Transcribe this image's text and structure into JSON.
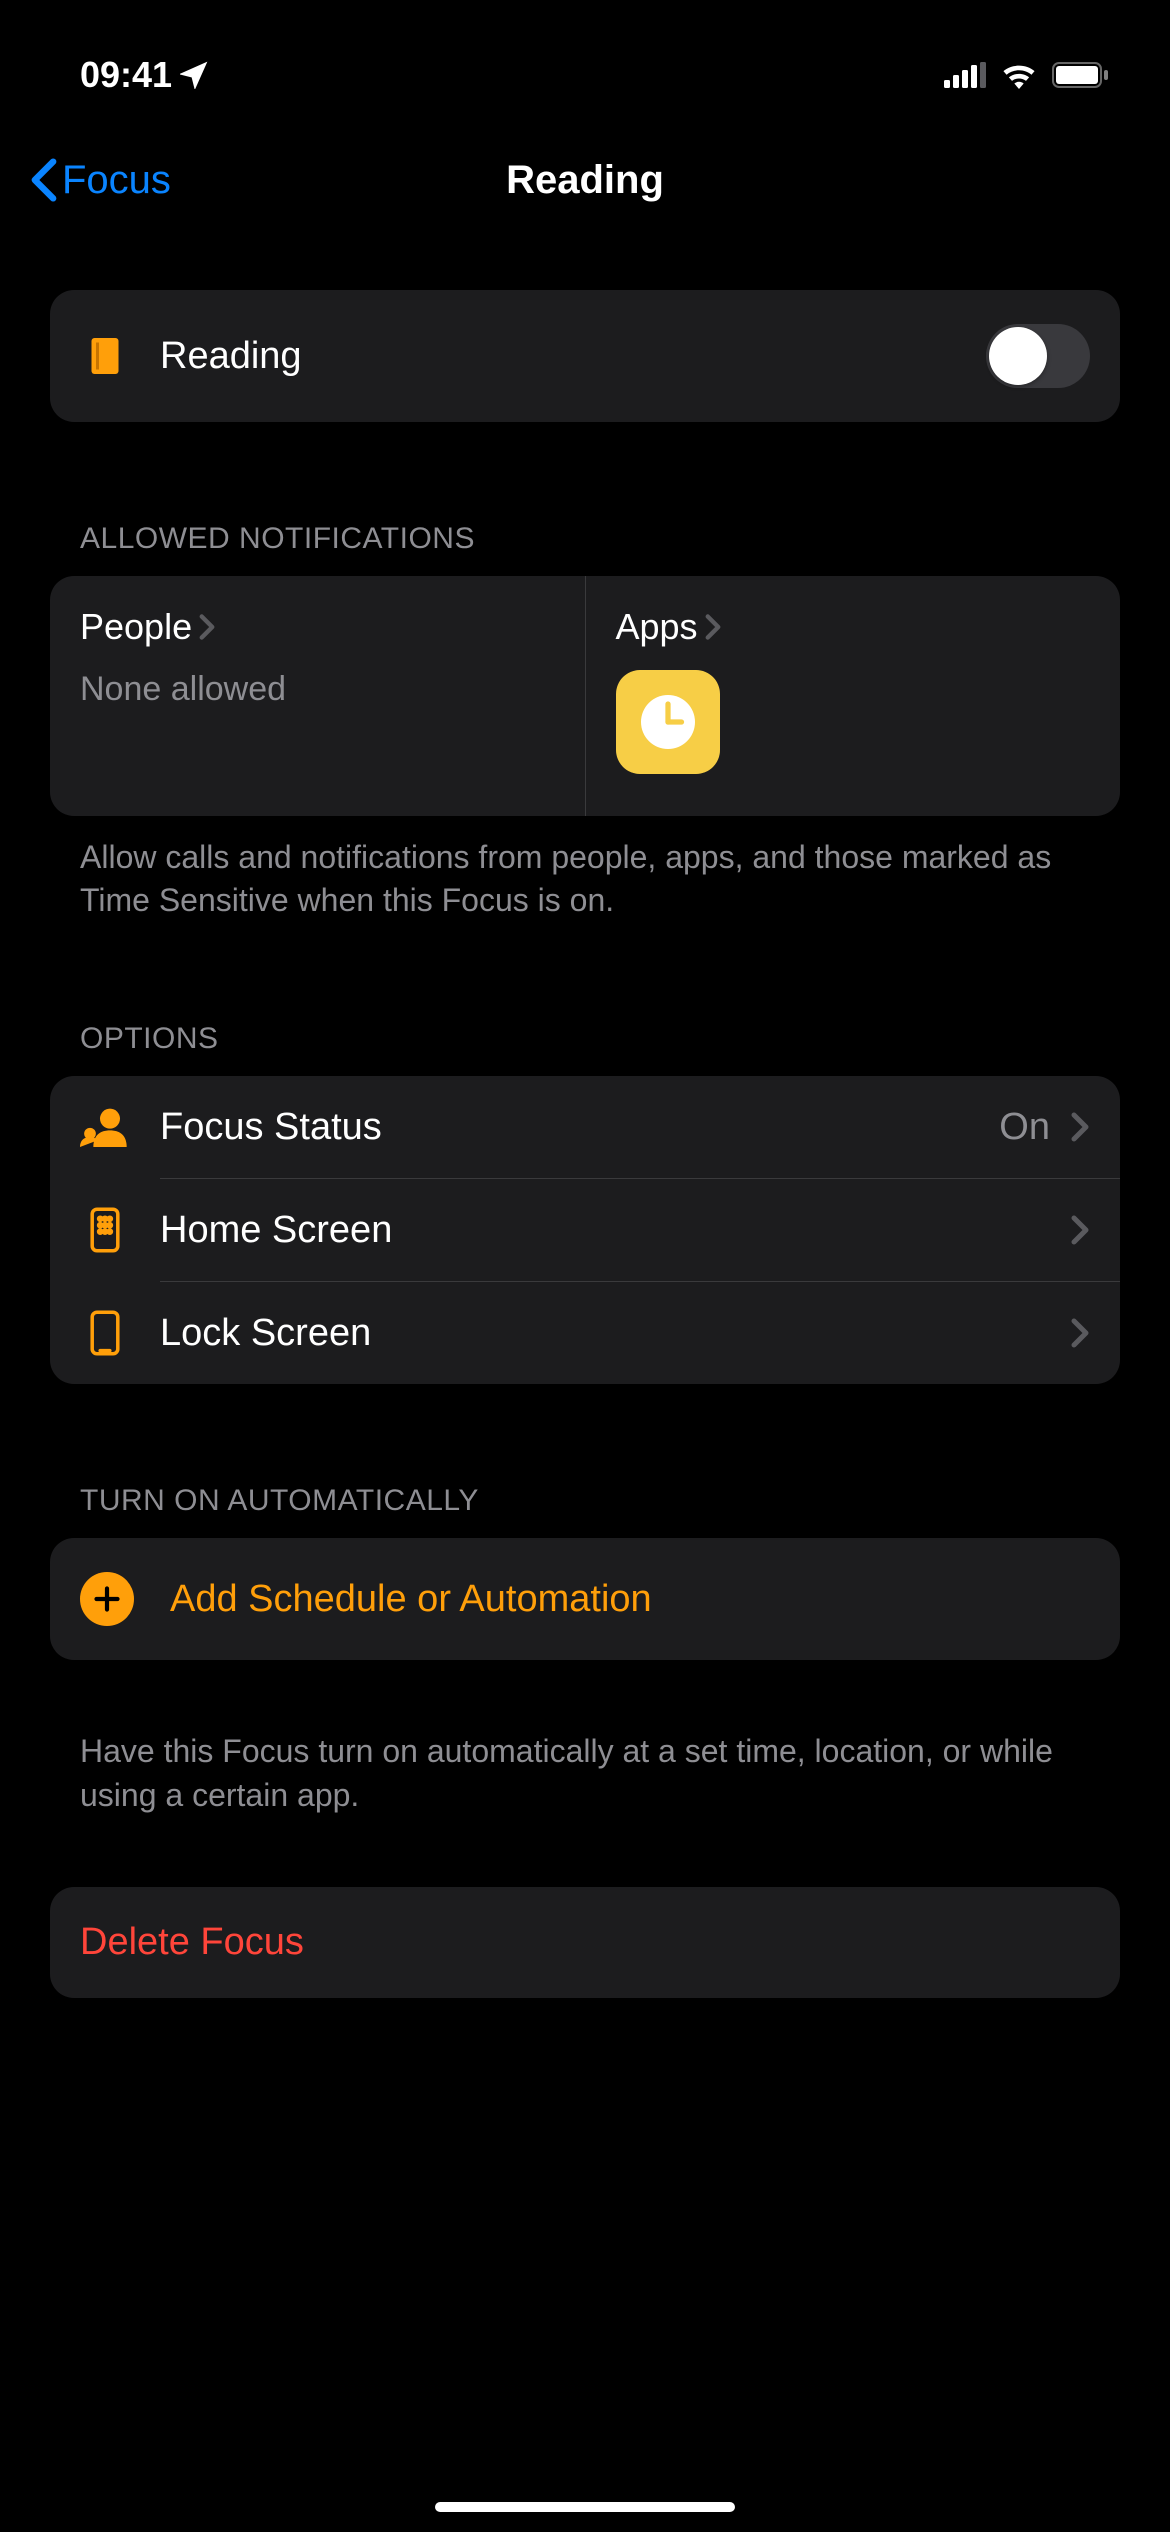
{
  "status": {
    "time": "09:41"
  },
  "nav": {
    "back": "Focus",
    "title": "Reading"
  },
  "toggle": {
    "label": "Reading",
    "on": false
  },
  "allowed": {
    "header": "ALLOWED NOTIFICATIONS",
    "people_label": "People",
    "people_value": "None allowed",
    "apps_label": "Apps",
    "footer": "Allow calls and notifications from people, apps, and those marked as Time Sensitive when this Focus is on."
  },
  "options": {
    "header": "OPTIONS",
    "focus_status": {
      "label": "Focus Status",
      "value": "On"
    },
    "home_screen": {
      "label": "Home Screen"
    },
    "lock_screen": {
      "label": "Lock Screen"
    }
  },
  "automation": {
    "header": "TURN ON AUTOMATICALLY",
    "add_label": "Add Schedule or Automation",
    "footer": "Have this Focus turn on automatically at a set time, location, or while using a certain app."
  },
  "delete": {
    "label": "Delete Focus"
  }
}
